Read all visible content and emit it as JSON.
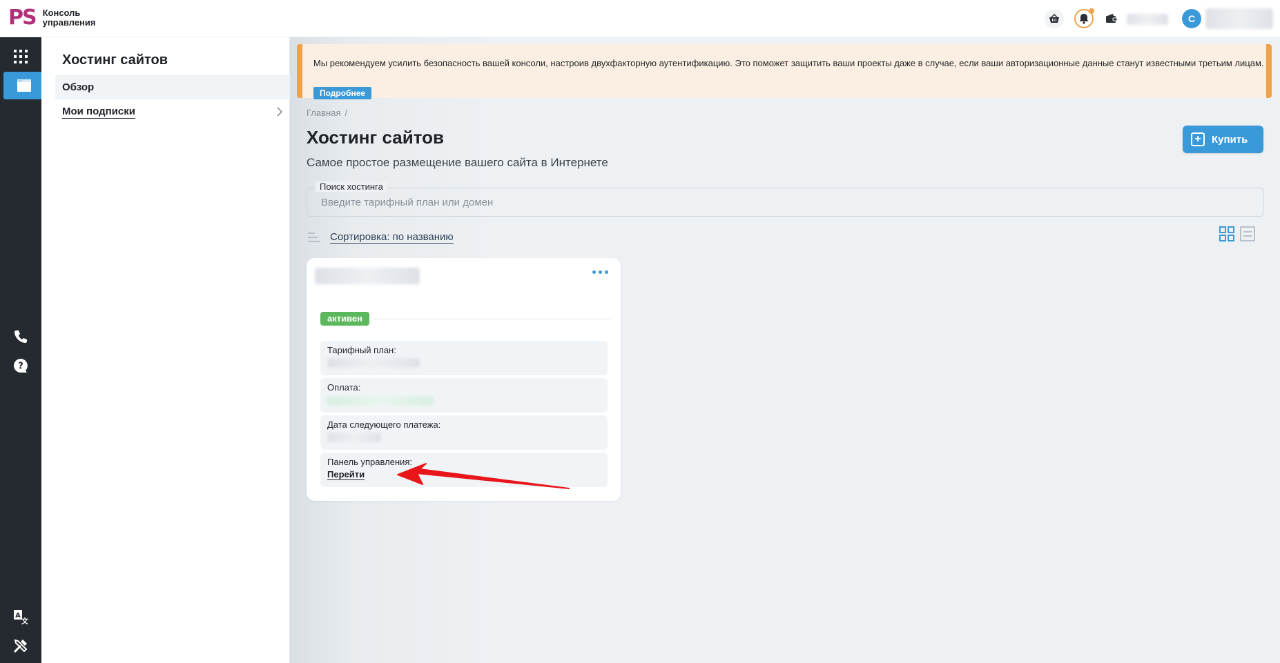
{
  "header": {
    "logo_mark": "PS",
    "logo_line1": "Консоль",
    "logo_line2": "управления",
    "avatar_letter": "С",
    "icons": [
      "basket-icon",
      "bell-icon",
      "wallet-icon"
    ]
  },
  "rail": {
    "icons": [
      "apps-grid-icon",
      "hosting-window-icon",
      "phone-icon",
      "help-icon",
      "translate-icon",
      "tools-icon"
    ]
  },
  "subnav": {
    "title": "Хостинг сайтов",
    "items": [
      {
        "label": "Обзор",
        "active": true
      },
      {
        "label": "Мои подписки",
        "active": false
      }
    ]
  },
  "alert": {
    "text": "Мы рекомендуем усилить безопасность вашей консоли, настроив двухфакторную аутентификацию. Это поможет защитить ваши проекты даже в случае, если ваши авторизационные данные станут известными третьим лицам.",
    "button": "Подробнее"
  },
  "breadcrumb": {
    "home": "Главная",
    "separator": "/"
  },
  "page": {
    "title": "Хостинг сайтов",
    "subtitle": "Самое простое размещение вашего сайта в Интернете",
    "buy_button": "Купить"
  },
  "search": {
    "label": "Поиск хостинга",
    "placeholder": "Введите тарифный план или домен",
    "value": ""
  },
  "sort": {
    "label": "Сортировка: по названию"
  },
  "card": {
    "status": "активен",
    "fields": [
      {
        "label": "Тарифный план:"
      },
      {
        "label": "Оплата:"
      },
      {
        "label": "Дата следующего платежа:"
      },
      {
        "label": "Панель управления:",
        "link": "Перейти"
      }
    ]
  },
  "colors": {
    "accent": "#3a9ad9",
    "rail": "#252a31",
    "brand": "#b0317a",
    "status_active": "#5cb85c",
    "alert_border": "#f0a24a",
    "annotation_arrow": "#e8161b"
  }
}
